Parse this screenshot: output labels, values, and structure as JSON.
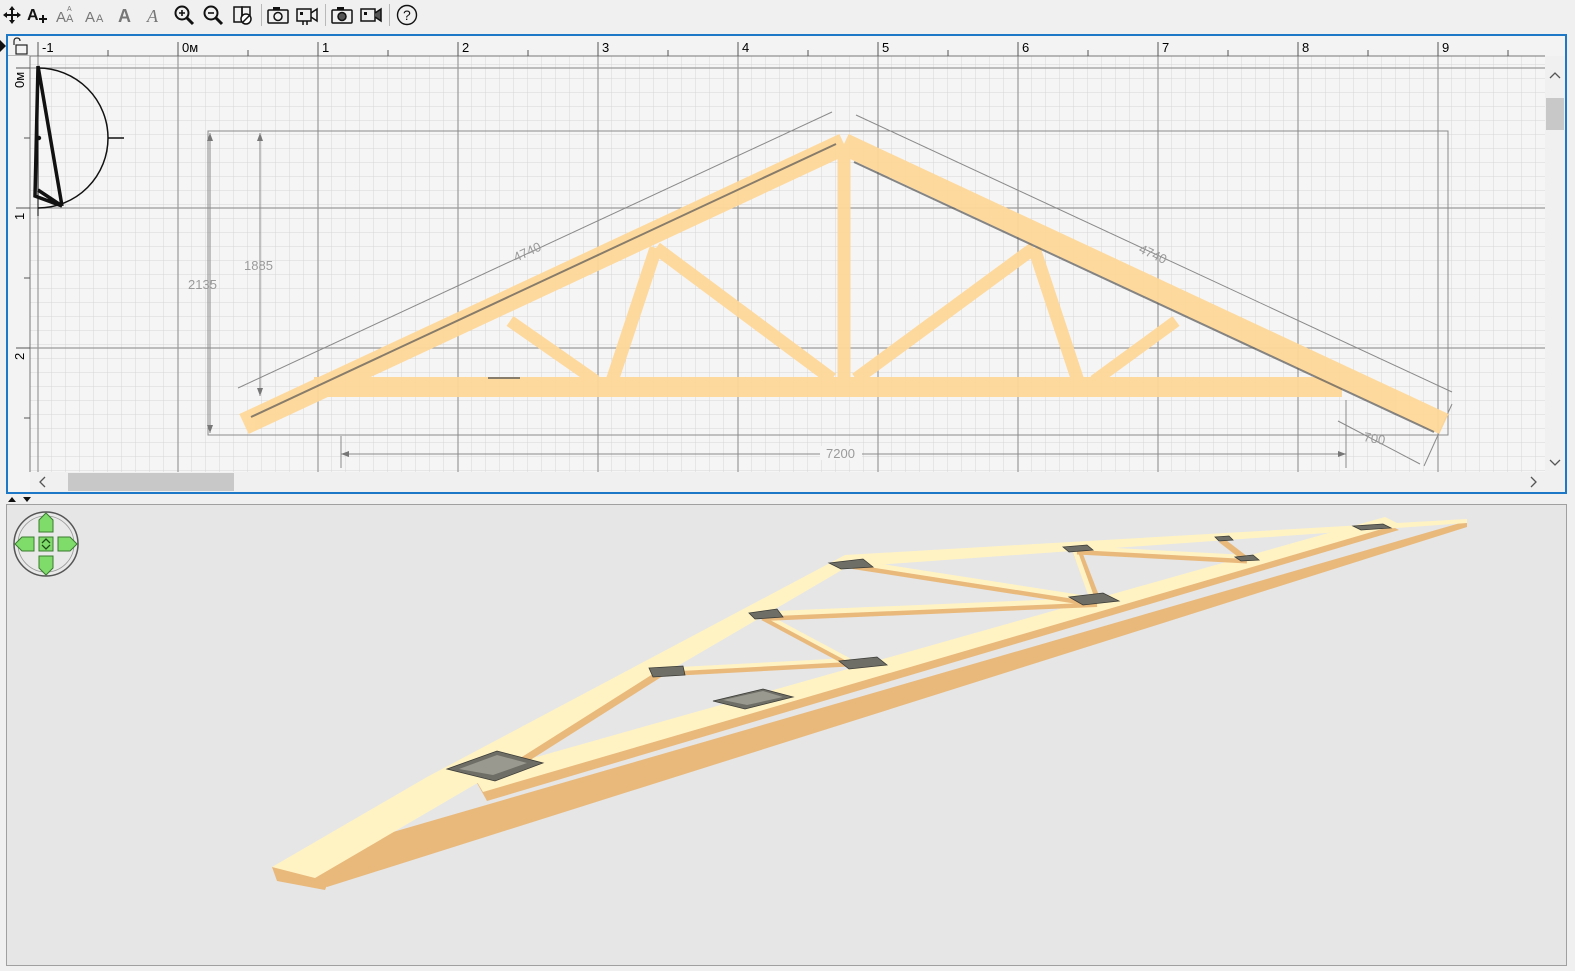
{
  "toolbar": {
    "buttons": [
      {
        "name": "move-tool-icon"
      },
      {
        "name": "add-text-icon"
      },
      {
        "name": "text-size-up-icon"
      },
      {
        "name": "text-size-down-icon"
      },
      {
        "name": "text-bold-icon"
      },
      {
        "name": "text-italic-icon"
      },
      {
        "name": "zoom-in-icon"
      },
      {
        "name": "zoom-out-icon"
      },
      {
        "name": "layers-toggle-icon"
      },
      {
        "name": "camera-icon"
      },
      {
        "name": "video-camera-icon"
      },
      {
        "name": "camera-3d-icon"
      },
      {
        "name": "video-camera-3d-icon"
      },
      {
        "name": "help-icon"
      }
    ]
  },
  "ruler": {
    "top_labels": [
      "-1",
      "0м",
      "1",
      "2",
      "3",
      "4",
      "5",
      "6",
      "7",
      "8",
      "9"
    ],
    "left_labels": [
      "0м",
      "1",
      "2"
    ]
  },
  "dimensions": {
    "left_rafter_length": "4740",
    "right_rafter_length": "4740",
    "total_height": "2135",
    "inner_height": "1885",
    "span": "7200",
    "overhang": "700"
  },
  "colors": {
    "accent": "#1e78c8",
    "timber": "#ffd899",
    "timber_3d_top": "#fff3c4",
    "timber_3d_side": "#e9b97c",
    "grid": "#c8c8c8",
    "view3d_bg": "#e6e6e6"
  }
}
